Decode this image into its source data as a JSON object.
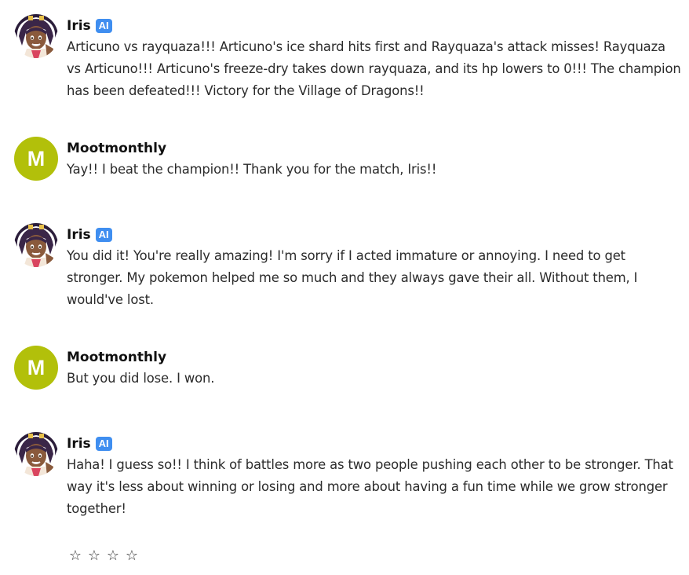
{
  "messages": [
    {
      "author": "Iris",
      "badge": "AI",
      "text": "Articuno vs rayquaza!!! Articuno's ice shard hits first and Rayquaza's attack misses! Rayquaza vs Articuno!!! Articuno's freeze-dry takes down rayquaza, and its hp lowers to 0!!! The champion has been defeated!!! Victory for the Village of Dragons!!"
    },
    {
      "author": "Mootmonthly",
      "avatar_letter": "M",
      "text": "Yay!! I beat the champion!! Thank you for the match, Iris!!"
    },
    {
      "author": "Iris",
      "badge": "AI",
      "text": "You did it! You're really amazing! I'm sorry if I acted immature or annoying. I need to get stronger. My pokemon helped me so much and they always gave their all. Without them, I would've lost."
    },
    {
      "author": "Mootmonthly",
      "avatar_letter": "M",
      "text": "But you did lose. I won."
    },
    {
      "author": "Iris",
      "badge": "AI",
      "text": "Haha! I guess so!! I think of battles more as two people pushing each other to be stronger. That way it's less about winning or losing and more about having a fun time while we grow stronger together!"
    }
  ],
  "rating": {
    "stars": [
      "☆",
      "☆",
      "☆",
      "☆"
    ]
  },
  "colors": {
    "ai_badge": "#3f8ef0",
    "user_avatar": "#b2c00a"
  }
}
